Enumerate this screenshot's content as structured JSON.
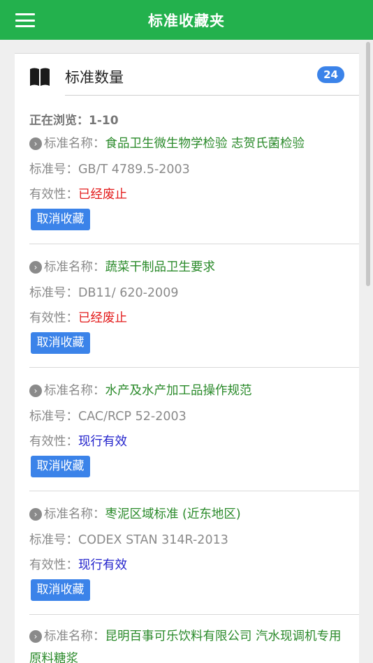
{
  "header": {
    "title": "标准收藏夹",
    "menu_icon": "hamburger-menu-icon"
  },
  "summary": {
    "title": "标准数量",
    "count": "24",
    "icon": "book-icon",
    "range_text": "正在浏览：1-10"
  },
  "labels": {
    "name": "标准名称：",
    "code": "标准号：",
    "status": "有效性："
  },
  "items": [
    {
      "name": "食品卫生微生物学检验 志贺氏菌检验",
      "code": "GB/T 4789.5-2003",
      "status": "已经废止",
      "status_color": "#e31b1b",
      "button": "取消收藏"
    },
    {
      "name": "蔬菜干制品卫生要求",
      "code": "DB11/ 620-2009",
      "status": "已经废止",
      "status_color": "#e31b1b",
      "button": "取消收藏"
    },
    {
      "name": "水产及水产加工品操作规范",
      "code": "CAC/RCP 52-2003",
      "status": "现行有效",
      "status_color": "#2222cc",
      "button": "取消收藏"
    },
    {
      "name": "枣泥区域标准 (近东地区)",
      "code": "CODEX STAN 314R-2013",
      "status": "现行有效",
      "status_color": "#2222cc",
      "button": "取消收藏"
    },
    {
      "name": "昆明百事可乐饮料有限公司 汽水现调机专用原料糖浆"
    }
  ],
  "colors": {
    "header_bg": "#23b14d",
    "badge_bg": "#3b83e9",
    "name_green": "#2a8a2a",
    "repealed_red": "#e31b1b",
    "active_blue": "#2222cc"
  }
}
